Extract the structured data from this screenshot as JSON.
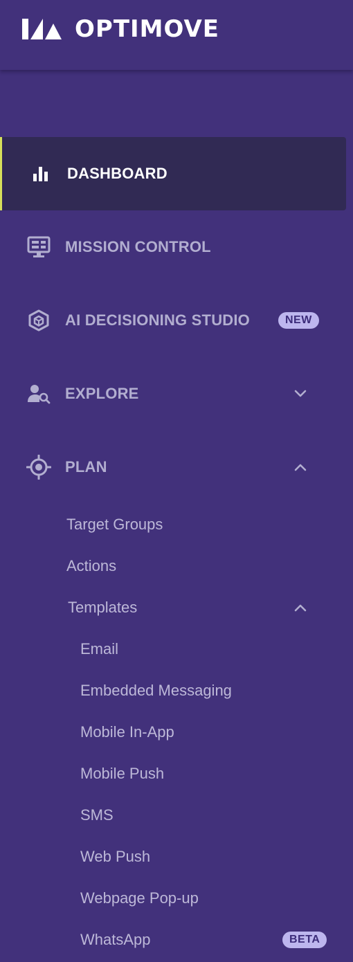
{
  "app": {
    "logo_text": "OPTIMOVE"
  },
  "colors": {
    "background": "#42317b",
    "active_background": "#312a54",
    "active_indicator": "#d6e05a",
    "badge_background": "#bdb6ee",
    "badge_text": "#3c2c7a",
    "label": "#b2aed0"
  },
  "nav": {
    "dashboard": {
      "label": "DASHBOARD",
      "icon": "bar-chart-icon",
      "active": true
    },
    "mission_control": {
      "label": "MISSION CONTROL",
      "icon": "monitor-icon"
    },
    "ai_decisioning": {
      "label": "AI DECISIONING STUDIO",
      "icon": "cube-icon",
      "badge": "NEW"
    },
    "explore": {
      "label": "EXPLORE",
      "icon": "user-search-icon",
      "expanded": false
    },
    "plan": {
      "label": "PLAN",
      "icon": "target-icon",
      "expanded": true,
      "items": {
        "target_groups": "Target Groups",
        "actions": "Actions",
        "templates": {
          "label": "Templates",
          "expanded": true,
          "items": {
            "email": "Email",
            "embedded_messaging": "Embedded Messaging",
            "mobile_in_app": "Mobile In-App",
            "mobile_push": "Mobile Push",
            "sms": "SMS",
            "web_push": "Web Push",
            "webpage_popup": "Webpage Pop-up",
            "whatsapp": {
              "label": "WhatsApp",
              "badge": "BETA"
            }
          }
        }
      }
    }
  }
}
